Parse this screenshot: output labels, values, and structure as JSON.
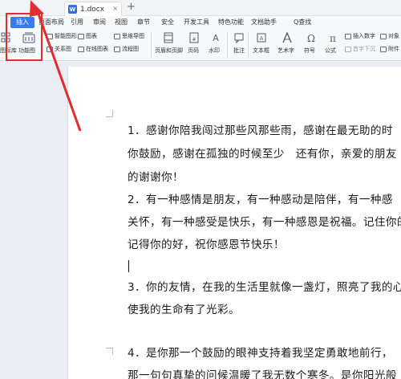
{
  "titlebar": {
    "doc_name": "1.docx",
    "doc_icon_letter": "W",
    "close_glyph": "×",
    "new_tab_glyph": "+"
  },
  "tabs": [
    {
      "label": "插入",
      "active": true
    },
    {
      "label": "页面布局"
    },
    {
      "label": "引用"
    },
    {
      "label": "审阅"
    },
    {
      "label": "视图"
    },
    {
      "label": "章节"
    },
    {
      "label": "安全"
    },
    {
      "label": "开发工具"
    },
    {
      "label": "特色功能"
    },
    {
      "label": "文档助手"
    }
  ],
  "search_label": "Q查找",
  "ribbon": {
    "big": {
      "iconlib": "图标库",
      "funcmap": "功能图",
      "header_footer": "页眉和页脚",
      "page_number": "页码",
      "watermark": "水印",
      "comment": "批注",
      "textbox": "文本框",
      "wordart": "艺术字",
      "symbol": "符号",
      "formula": "公式"
    },
    "small": {
      "smart_shape": "智能图形",
      "chart": "图表",
      "mindmap": "思维导图",
      "relation": "关系图",
      "online_chart": "在线图表",
      "flowchart": "流程图",
      "insert_number": "插入数字",
      "object": "对象",
      "first_sink": "首字下沉",
      "attachment": "附件"
    }
  },
  "annotation_color": "#e02d2d",
  "document_lines": [
    "1．感谢你陪我闯过那些风那些雨，感谢在最无助的时",
    "你鼓励，感谢在孤独的时候至少　还有你，亲爱的朋友",
    "的谢谢你！",
    "2．有一种感情是朋友，有一种感动是陪伴，有一种感",
    "关怀，有一种感受是快乐，有一种感恩是祝福。记住你的",
    "记得你的好，祝你感恩节快乐！",
    "3．你的友情，在我的生活里就像一盏灯，照亮了我的心",
    "使我的生命有了光彩。",
    "4．是你那一个鼓励的眼神支持着我坚定勇敢地前行，",
    "那一句句真挚的问候温暖了我无数个寒冬。是你阳光般"
  ]
}
